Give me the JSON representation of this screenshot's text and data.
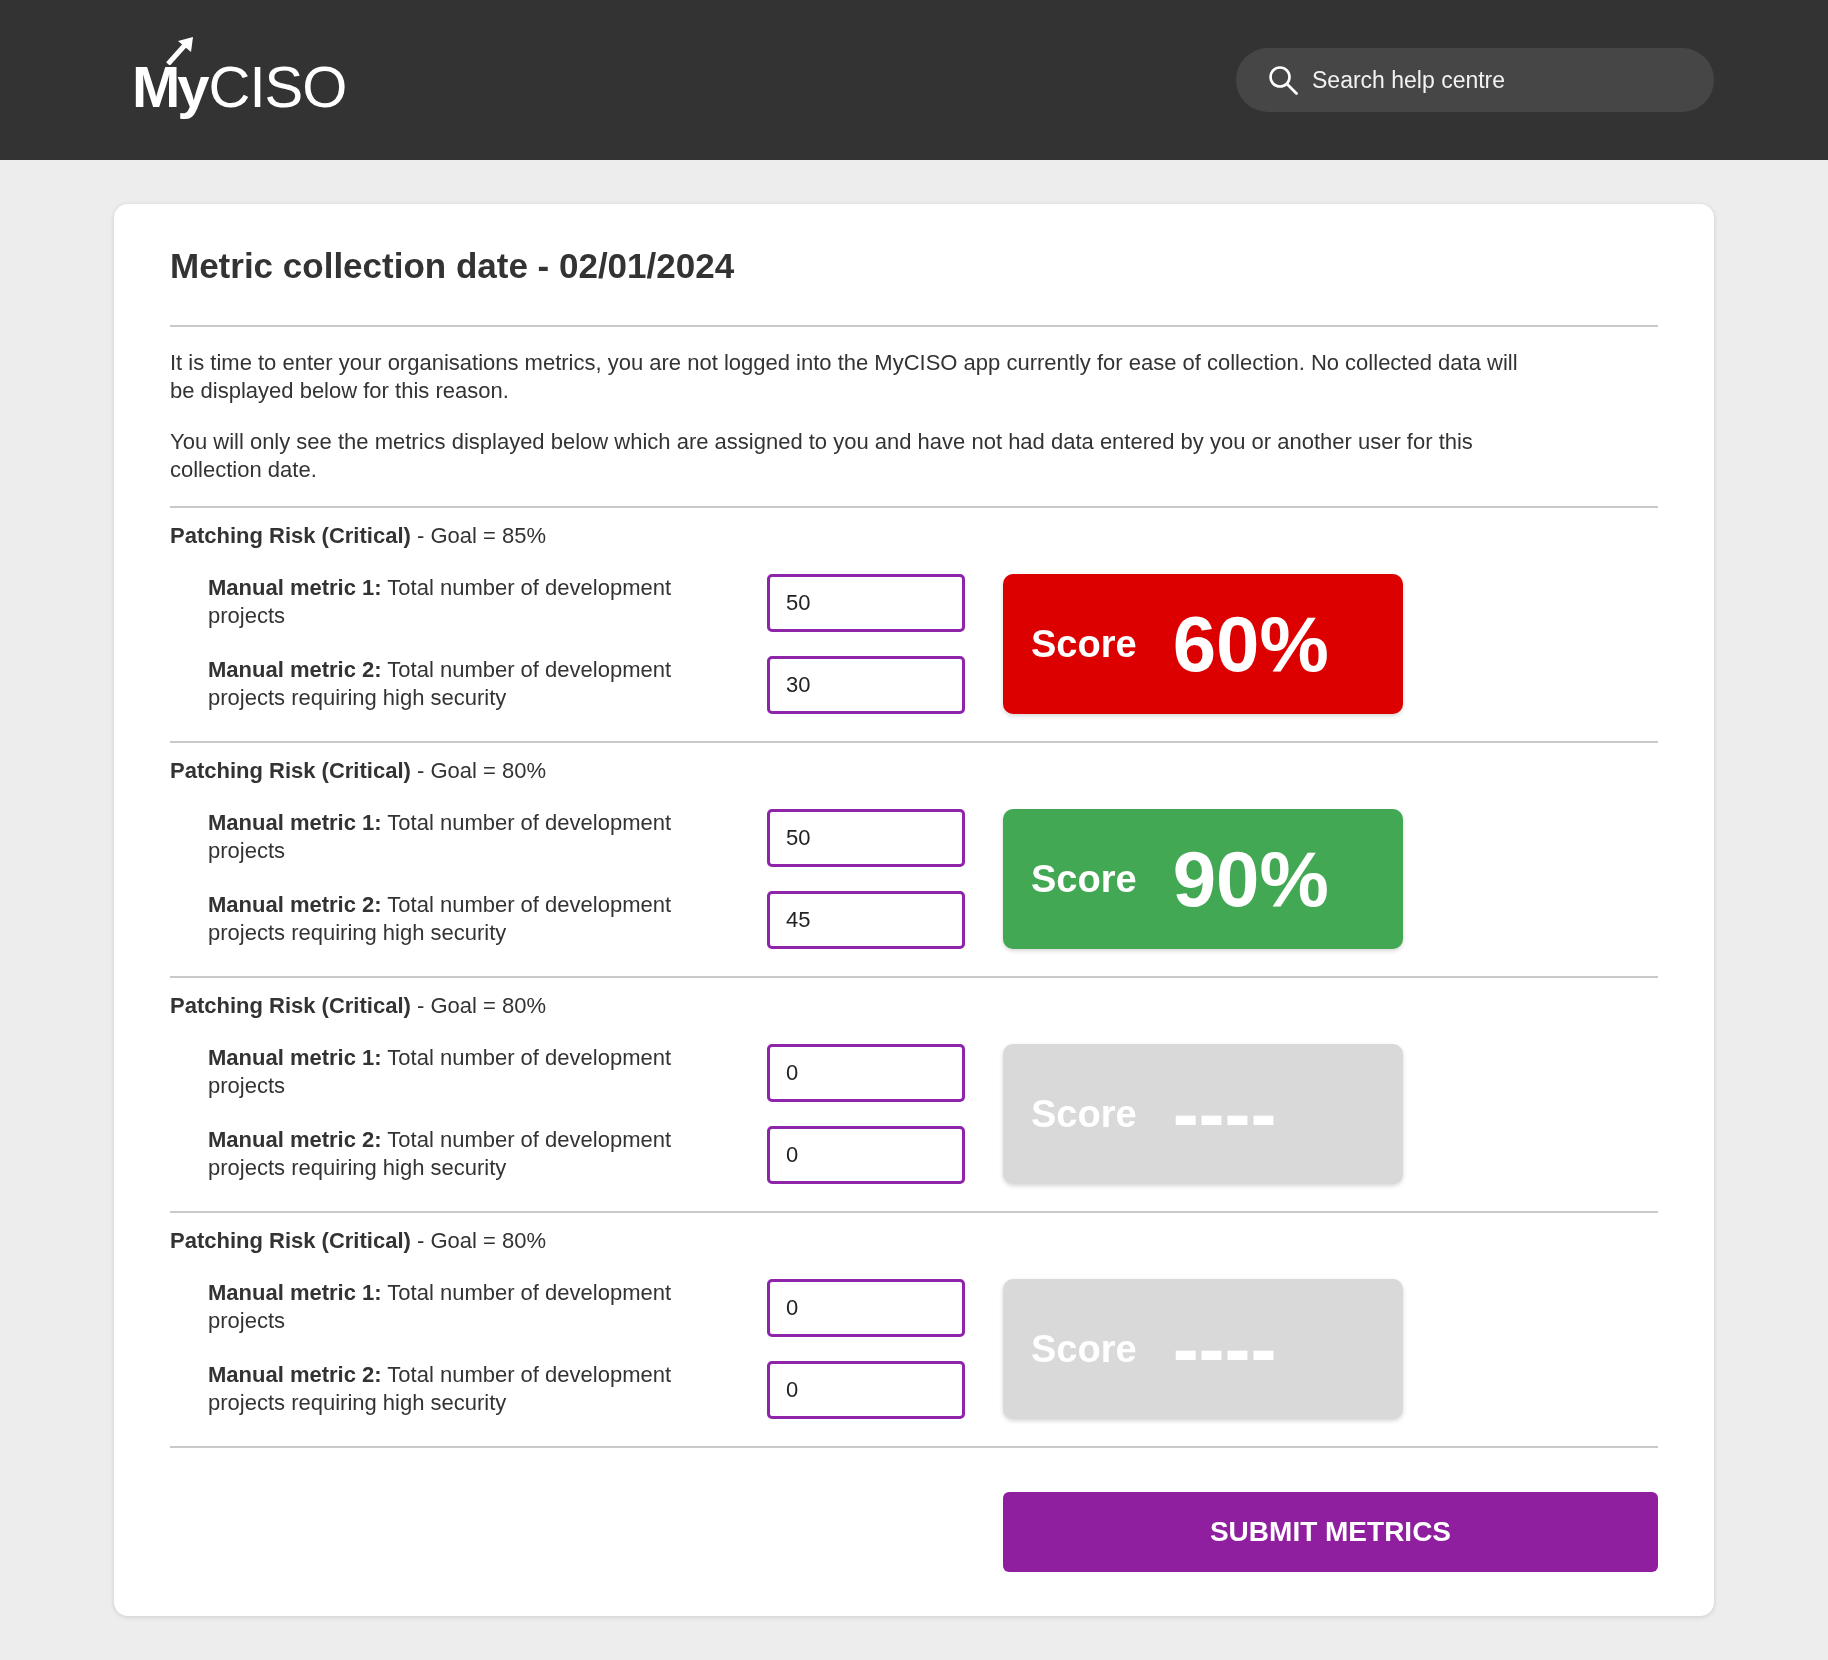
{
  "header": {
    "logo": "**My**CISO",
    "search": {
      "placeholder": "Search help centre"
    }
  },
  "form": {
    "title": "Metric collection date - 02/01/2024",
    "intro": [
      "It is time to enter your organisations metrics, you are not logged into the MyCISO app currently for ease of collection. No collected data will be displayed below for this reason.",
      "You will only see the metrics displayed below which are assigned to you and have not had data entered by you or another user for this collection date."
    ],
    "sections": [
      {
        "heading": "**Patching Risk (Critical)** - Goal = 85%",
        "metrics": [
          {
            "label": "**Manual metric 1:** Total number of development projects",
            "value": "50"
          },
          {
            "label": "**Manual metric 2:** Total number of development projects requiring high security",
            "value": "30"
          }
        ],
        "score": {
          "label": "Score",
          "value": "60%",
          "color": "#dd0000"
        }
      },
      {
        "heading": "**Patching Risk (Critical)** - Goal = 80%",
        "metrics": [
          {
            "label": "**Manual metric 1:** Total number of development projects",
            "value": "50"
          },
          {
            "label": "**Manual metric 2:** Total number of development projects requiring high security",
            "value": "45"
          }
        ],
        "score": {
          "label": "Score",
          "value": "90%",
          "color": "#43a853"
        }
      },
      {
        "heading": "**Patching Risk (Critical)** - Goal = 80%",
        "metrics": [
          {
            "label": "**Manual metric 1:** Total number of development projects",
            "value": "0"
          },
          {
            "label": "**Manual metric 2:** Total number of development projects requiring high security",
            "value": "0"
          }
        ],
        "score": {
          "label": "Score",
          "value": "----",
          "color": "#d9d9d9"
        }
      },
      {
        "heading": "**Patching Risk (Critical)** - Goal = 80%",
        "metrics": [
          {
            "label": "**Manual metric 1:** Total number of development projects",
            "value": "0"
          },
          {
            "label": "**Manual metric 2:** Total number of development projects requiring high security",
            "value": "0"
          }
        ],
        "score": {
          "label": "Score",
          "value": "----",
          "color": "#d9d9d9"
        }
      }
    ],
    "submit": "SUBMIT METRICS"
  }
}
